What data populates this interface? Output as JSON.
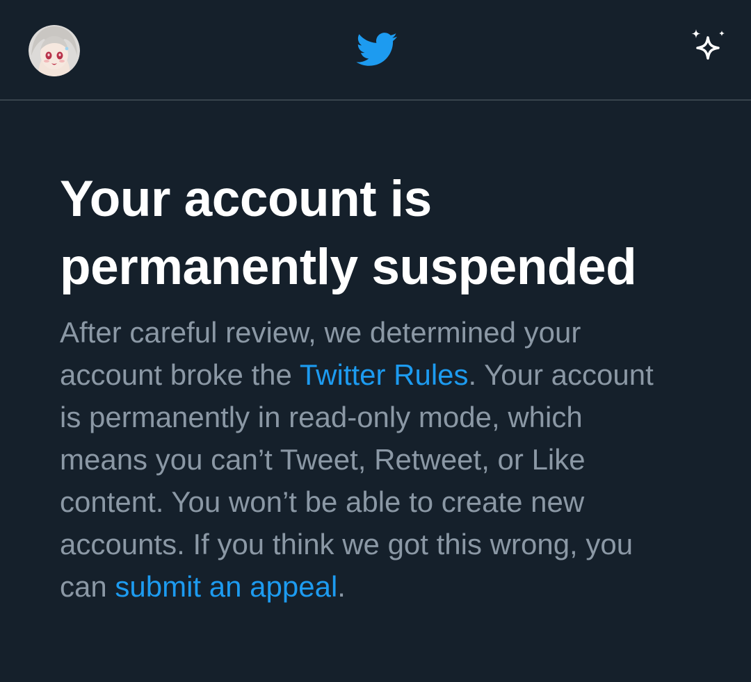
{
  "header": {
    "avatar_icon": "user-avatar",
    "logo_icon": "twitter-bird-icon",
    "sparkle_icon": "sparkle-icon",
    "logo_color": "#1d9bf0"
  },
  "notice": {
    "title": "Your account is permanently suspended",
    "body": {
      "part1": "After careful review, we determined your account broke the ",
      "rules_link": "Twitter Rules",
      "part2": ". Your account is permanently in read-only mode, which means you can’t Tweet, Retweet, or Like content. You won’t be able to create new accounts. If you think we got this wrong, you can ",
      "appeal_link": "submit an appeal",
      "part3": "."
    }
  },
  "colors": {
    "background": "#15202b",
    "title": "#ffffff",
    "body_text": "#8b98a5",
    "link": "#1d9bf0",
    "divider": "#38444d"
  }
}
